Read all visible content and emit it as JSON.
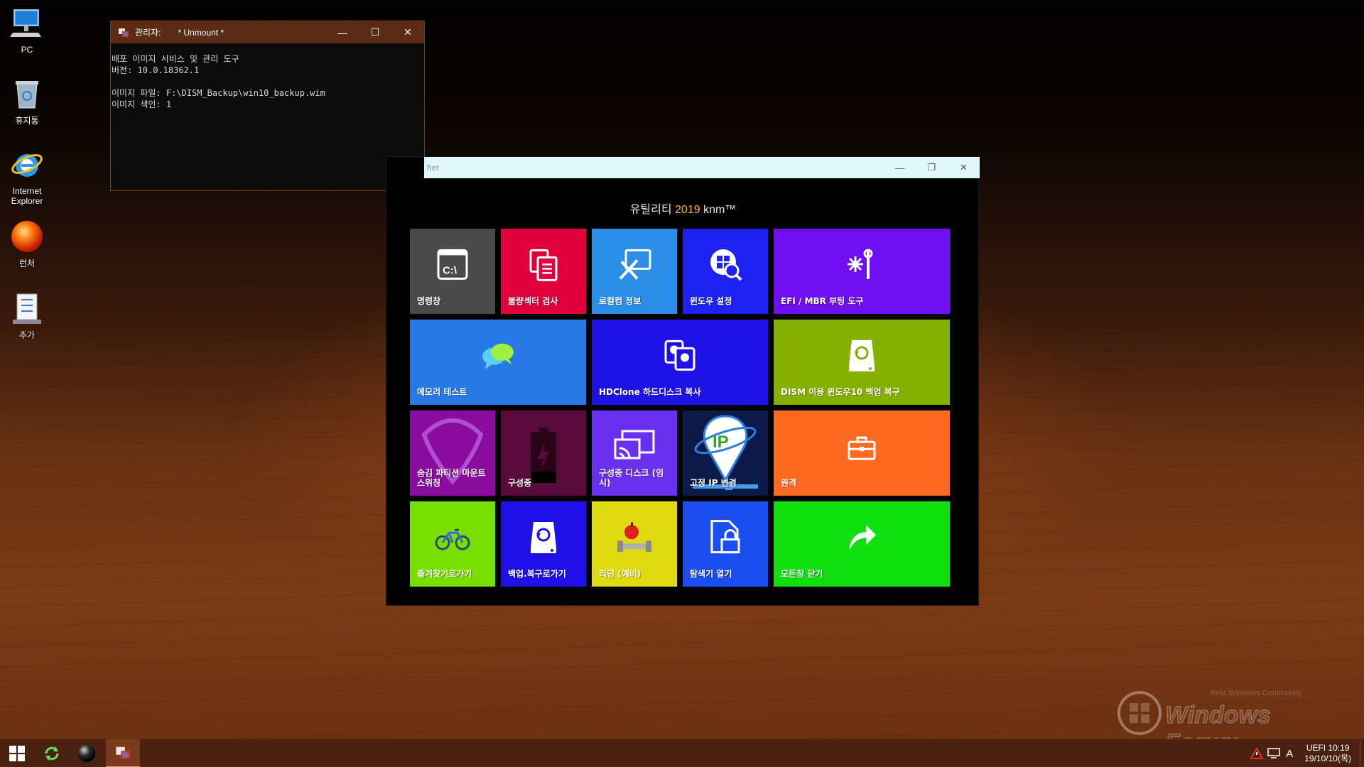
{
  "desktop": {
    "icons": [
      {
        "label": "PC",
        "icon": "computer-icon"
      },
      {
        "label": "휴지통",
        "icon": "recycle-bin-icon"
      },
      {
        "label": "Internet Explorer",
        "icon": "ie-icon"
      },
      {
        "label": "런처",
        "icon": "launcher-orb-icon"
      },
      {
        "label": "추가",
        "icon": "checklist-icon"
      }
    ]
  },
  "console": {
    "title_prefix": "관리자:",
    "title": "* Unmount *",
    "lines": [
      "배포 이미지 서비스 및 관리 도구",
      "버전: 10.0.18362.1",
      "",
      "이미지 파일: F:\\DISM_Backup\\win10_backup.wim",
      "이미지 색인: 1"
    ]
  },
  "launcher": {
    "title": "her",
    "heading_prefix": "유틸리티",
    "heading_year": "2019",
    "heading_suffix": "knm™",
    "tiles": [
      {
        "label": "명령창",
        "color": "#4a4a4a",
        "icon": "cmd-icon"
      },
      {
        "label": "불량섹터 검사",
        "color": "#e0003c",
        "icon": "documents-icon"
      },
      {
        "label": "로컬컴 정보",
        "color": "#2b8fe8",
        "icon": "tools-icon"
      },
      {
        "label": "윈도우 설정",
        "color": "#1e22f0",
        "icon": "windows-search-icon"
      },
      {
        "label": "EFI / MBR 부팅 도구",
        "color": "#6f0ef0",
        "icon": "wrench-icon"
      },
      {
        "label": "메모리 테스트",
        "color": "#2878e6",
        "icon": "chat-bubbles-icon"
      },
      {
        "label": "HDClone 하드디스크 복사",
        "color": "#1e12e6",
        "icon": "disk-clone-icon"
      },
      {
        "label": "DISM 이용 윈도우10 백업 복구",
        "color": "#86b000",
        "icon": "backup-drive-icon"
      },
      {
        "label": "숨김 파티션 마운트 스위칭",
        "color": "#8a0c9e",
        "icon": "guitar-pick-icon"
      },
      {
        "label": "구성중",
        "color": "#5a0a3a",
        "icon": "battery-icon"
      },
      {
        "label": "구성중 디스크 (임시)",
        "color": "#6a30f0",
        "icon": "cast-screen-icon"
      },
      {
        "label": "고정 IP 변경",
        "color": "#0c1a4a",
        "icon": "ip-pin-icon"
      },
      {
        "label": "원격",
        "color": "#ff6a20",
        "icon": "briefcase-icon"
      },
      {
        "label": "즐겨찾기로가기",
        "color": "#78e000",
        "icon": "bicycle-icon"
      },
      {
        "label": "백업.복구로가기",
        "color": "#2010e8",
        "icon": "restore-drive-icon"
      },
      {
        "label": "리턴 (예비)",
        "color": "#e0da10",
        "icon": "fitness-icon"
      },
      {
        "label": "탐색기 열기",
        "color": "#1a4ef0",
        "icon": "lock-file-icon"
      },
      {
        "label": "모든창 닫기",
        "color": "#10e010",
        "icon": "share-arrow-icon"
      }
    ]
  },
  "watermark": {
    "text": "Windows Forum",
    "sub": "Best Windows Community"
  },
  "taskbar": {
    "tray_lang": "A",
    "clock_top": "UEFI 10:19",
    "clock_bottom": "19/10/10(목)"
  }
}
